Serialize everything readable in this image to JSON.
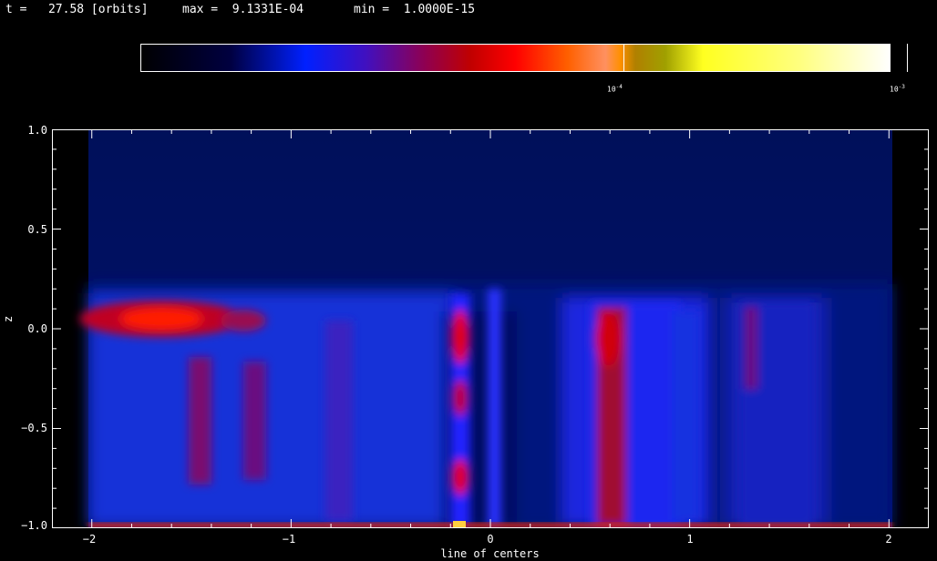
{
  "header": {
    "time_text": "t =   27.58 [orbits]",
    "max_text": "max =  9.1331E-04",
    "min_text": "min =  1.0000E-15"
  },
  "colorbar": {
    "colors": [
      "#000000",
      "#000040",
      "#1010ff",
      "#b00000",
      "#ff0000",
      "#ff9000",
      "#a0a000",
      "#ffff40",
      "#ffffff"
    ],
    "ticks": [
      {
        "base": "10",
        "exp": "-4"
      },
      {
        "base": "10",
        "exp": "-3"
      }
    ]
  },
  "chart_data": {
    "type": "heatmap",
    "title": "",
    "xlabel": "line of centers",
    "ylabel": "z",
    "xlim": [
      -2.2,
      2.2
    ],
    "ylim": [
      -1.0,
      1.0
    ],
    "x_ticks": [
      "−2",
      "−1",
      "0",
      "1",
      "2"
    ],
    "y_ticks": [
      "1.0",
      "0.5",
      "0.0",
      "−0.5",
      "−1.0"
    ],
    "color_scale": "log",
    "value_range": [
      1e-15,
      0.00091331
    ],
    "features": [
      {
        "x": -1.6,
        "z": 0.05,
        "level": 0.85
      },
      {
        "x": -0.17,
        "z": 0.0,
        "level": 0.8
      },
      {
        "x": -0.17,
        "z": -0.35,
        "level": 0.7
      },
      {
        "x": -0.17,
        "z": -0.75,
        "level": 0.75
      },
      {
        "x": 0.55,
        "z": -0.05,
        "level": 0.7
      },
      {
        "x": 0.6,
        "z": -0.7,
        "level": 0.6
      },
      {
        "x": 1.3,
        "z": -0.1,
        "level": 0.55
      },
      {
        "x": -1.3,
        "z": -0.5,
        "level": 0.45
      }
    ]
  }
}
